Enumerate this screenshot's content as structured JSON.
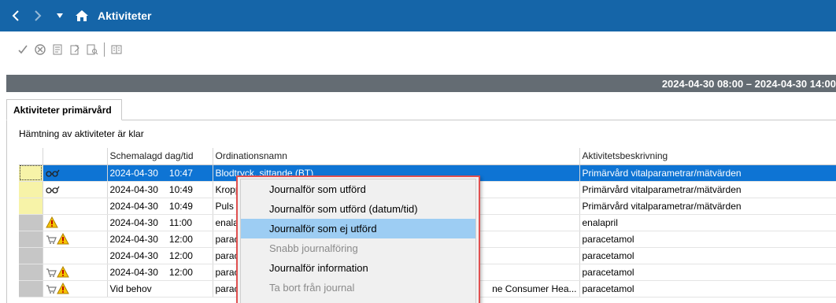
{
  "titlebar": {
    "title": "Aktiviteter",
    "bg": "#1565a8"
  },
  "toolbar": {
    "icons": [
      "check-icon",
      "cancel-circle-icon",
      "journal-icon",
      "sign-icon",
      "document-search-icon",
      "book-icon"
    ]
  },
  "datebar": {
    "range": "2024-04-30 08:00 – 2024-04-30 14:00"
  },
  "tab": {
    "label": "Aktiviteter primärvård"
  },
  "status": {
    "text": "Hämtning av aktiviteter är klar"
  },
  "grid": {
    "headers": [
      "",
      "",
      "Schemalagd dag/tid",
      "Ordinationsnamn",
      "Aktivitetsbeskrivning"
    ],
    "rows": [
      {
        "date": "2024-04-30",
        "time": "10:47",
        "name": "Blodtryck, sittande (BT)",
        "desc": "Primärvård vitalparametrar/mätvärden",
        "flag": "yellow",
        "icon": "glasses-icon",
        "selected": true
      },
      {
        "date": "2024-04-30",
        "time": "10:49",
        "name": "Kroppstemperatur",
        "desc": "Primärvård vitalparametrar/mätvärden",
        "flag": "yellow",
        "icon": "glasses-icon",
        "selected": false
      },
      {
        "date": "2024-04-30",
        "time": "10:49",
        "name": "Puls",
        "desc": "Primärvård vitalparametrar/mätvärden",
        "flag": "yellow",
        "icon": "",
        "selected": false
      },
      {
        "date": "2024-04-30",
        "time": "11:00",
        "name": "enalapril",
        "desc": "enalapril",
        "flag": "gray",
        "icon": "warning-icon",
        "selected": false
      },
      {
        "date": "2024-04-30",
        "time": "12:00",
        "name": "paracetamol",
        "desc": "paracetamol",
        "flag": "gray",
        "icon": "cart-warning-icon",
        "selected": false
      },
      {
        "date": "2024-04-30",
        "time": "12:00",
        "name": "paracetamol",
        "desc": "paracetamol",
        "flag": "gray",
        "icon": "",
        "selected": false
      },
      {
        "date": "2024-04-30",
        "time": "12:00",
        "name": "paracetamol",
        "desc": "paracetamol",
        "flag": "gray",
        "icon": "cart-warning-icon",
        "selected": false
      },
      {
        "date": "Vid behov",
        "time": "",
        "name": "paracetamol",
        "name_tail": "ne Consumer Hea...",
        "desc": "paracetamol",
        "flag": "gray",
        "icon": "cart-warning-icon",
        "selected": false
      }
    ]
  },
  "context_menu": {
    "items": [
      {
        "label": "Journalför som utförd",
        "state": "normal"
      },
      {
        "label": "Journalför som utförd (datum/tid)",
        "state": "normal"
      },
      {
        "label": "Journalför som ej utförd",
        "state": "highlighted"
      },
      {
        "label": "Snabb journalföring",
        "state": "disabled"
      },
      {
        "label": "Journalför information",
        "state": "normal"
      },
      {
        "label": "Ta bort från journal",
        "state": "disabled"
      }
    ]
  }
}
